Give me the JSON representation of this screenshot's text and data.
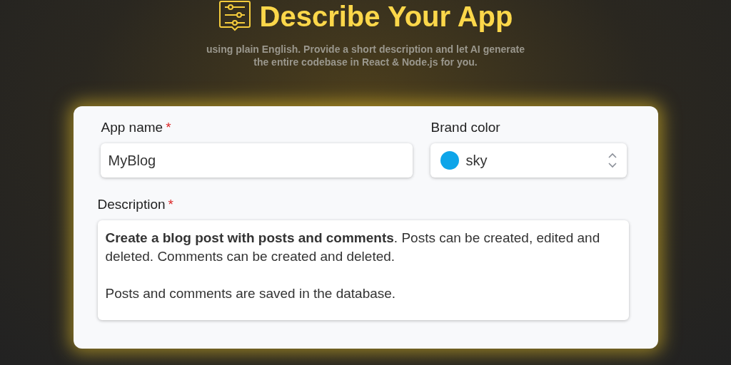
{
  "header": {
    "title": "Describe Your App",
    "subtitle_lines": [
      "using plain English. Provide a short description and let AI generate",
      "the entire codebase in React & Node.js for you."
    ]
  },
  "form": {
    "app_name": {
      "label": "App name",
      "required_mark": "*",
      "value": "MyBlog"
    },
    "brand_color": {
      "label": "Brand color",
      "value": "sky",
      "color": "#0ea5e9"
    },
    "description": {
      "label": "Description",
      "required_mark": "*",
      "paragraphs": [
        "**Create a blog post with posts and comments**. Posts can be created, edited and deleted. Comments can be created and deleted.",
        "Posts and comments are saved in the database."
      ]
    }
  }
}
